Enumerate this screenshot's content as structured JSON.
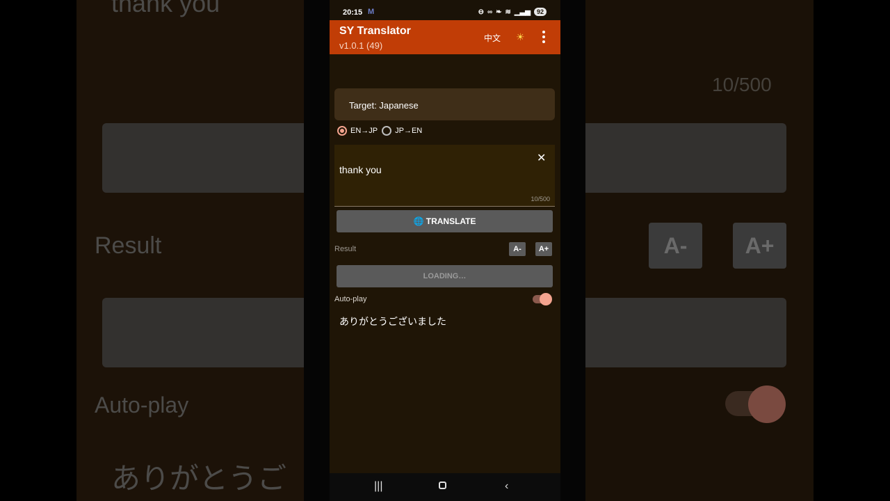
{
  "backdrop": {
    "left": {
      "top_text": "thank you",
      "result_label": "Result",
      "autoplay_label": "Auto-play",
      "result_text": "ありがとうご"
    },
    "right": {
      "count": "10/500",
      "font_smaller": "A-",
      "font_larger": "A+"
    }
  },
  "status_bar": {
    "time": "20:15",
    "battery": "92"
  },
  "app_bar": {
    "title": "SY Translator",
    "version": "v1.0.1 (49)",
    "language_toggle": "中文"
  },
  "target": {
    "label": "Target: Japanese"
  },
  "direction": {
    "options": [
      "EN→JP",
      "JP→EN"
    ],
    "selected": "EN→JP"
  },
  "input": {
    "value": "thank you",
    "counter": "10/500"
  },
  "translate_button": {
    "label": "🌐 TRANSLATE"
  },
  "result": {
    "label": "Result",
    "font_smaller": "A-",
    "font_larger": "A+",
    "loading_label": "LOADING…",
    "text": "ありがとうございました"
  },
  "autoplay": {
    "label": "Auto-play",
    "enabled": true
  },
  "colors": {
    "app_bar": "#c13d06",
    "accent": "#f4a48f",
    "background": "#1f1506"
  }
}
